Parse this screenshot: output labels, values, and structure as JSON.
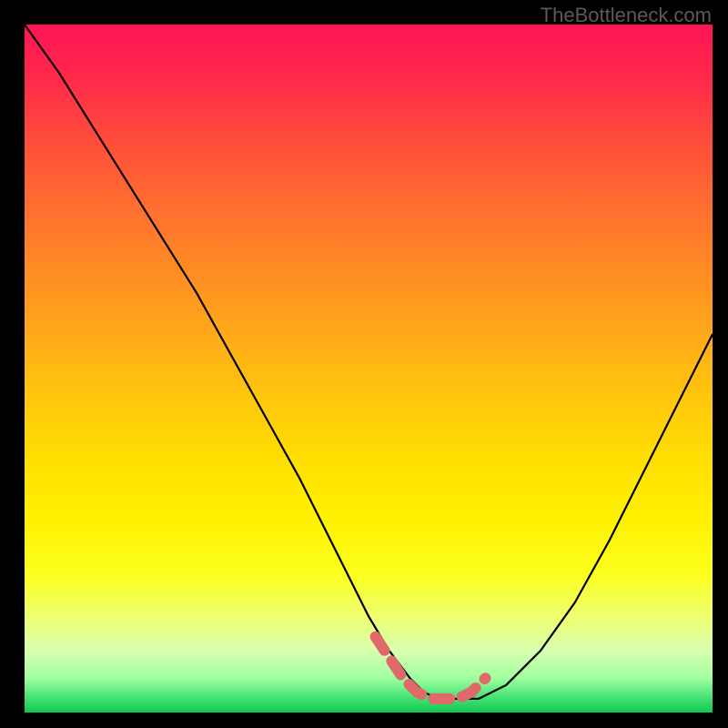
{
  "watermark": "TheBottleneck.com",
  "chart_data": {
    "type": "line",
    "title": "",
    "xlabel": "",
    "ylabel": "",
    "xlim": [
      0,
      100
    ],
    "ylim": [
      0,
      100
    ],
    "series": [
      {
        "name": "bottleneck-curve",
        "color": "#000000",
        "x": [
          0,
          5,
          10,
          15,
          20,
          25,
          30,
          35,
          40,
          45,
          50,
          53,
          56,
          58,
          60,
          63,
          66,
          70,
          75,
          80,
          85,
          90,
          95,
          100
        ],
        "y": [
          100,
          93,
          85,
          77,
          69,
          61,
          52,
          43,
          34,
          24,
          14,
          9,
          5,
          3,
          2,
          2,
          2,
          4,
          9,
          16,
          25,
          35,
          45,
          55
        ]
      },
      {
        "name": "optimal-range-marker",
        "color": "#e06a6a",
        "x": [
          51,
          53,
          55,
          57,
          59,
          61,
          63,
          65,
          67
        ],
        "y": [
          11,
          8,
          5,
          3,
          2,
          2,
          2,
          3,
          5
        ]
      }
    ],
    "gradient_stops": [
      {
        "pos": 0,
        "color": "#ff1455"
      },
      {
        "pos": 50,
        "color": "#ffcc0b"
      },
      {
        "pos": 80,
        "color": "#fcff20"
      },
      {
        "pos": 100,
        "color": "#10c850"
      }
    ]
  }
}
